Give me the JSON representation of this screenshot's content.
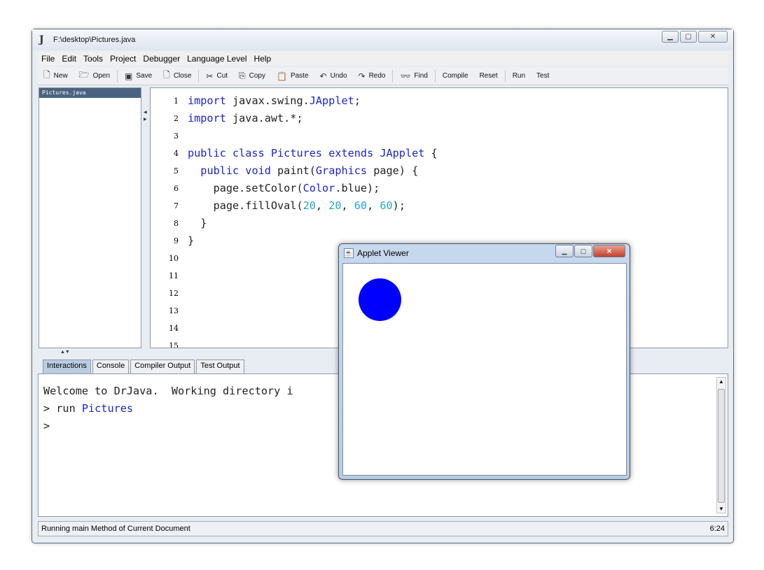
{
  "window": {
    "title": "F:\\desktop\\Pictures.java",
    "app_icon": "J"
  },
  "menu": [
    "File",
    "Edit",
    "Tools",
    "Project",
    "Debugger",
    "Language Level",
    "Help"
  ],
  "toolbar": {
    "new": "New",
    "open": "Open",
    "save": "Save",
    "close": "Close",
    "cut": "Cut",
    "copy": "Copy",
    "paste": "Paste",
    "undo": "Undo",
    "redo": "Redo",
    "find": "Find",
    "compile": "Compile",
    "reset": "Reset",
    "run": "Run",
    "test": "Test"
  },
  "files": [
    "Pictures.java"
  ],
  "editor": {
    "line_numbers": [
      "1",
      "2",
      "3",
      "4",
      "5",
      "6",
      "7",
      "8",
      "9",
      "10",
      "11",
      "12",
      "13",
      "14",
      "15"
    ]
  },
  "tabs": [
    "Interactions",
    "Console",
    "Compiler Output",
    "Test Output"
  ],
  "console": {
    "line1": "Welcome to DrJava.  Working directory i",
    "line2_prompt": "> run ",
    "line2_class": "Pictures",
    "line3": ">"
  },
  "status": {
    "message": "Running main Method of Current Document",
    "position": "6:24"
  },
  "applet": {
    "title": "Applet Viewer",
    "oval_color": "#0000ff"
  },
  "colors": {
    "keyword": "#1c24c8",
    "number": "#22a8c8",
    "selection": "#4a6380"
  }
}
